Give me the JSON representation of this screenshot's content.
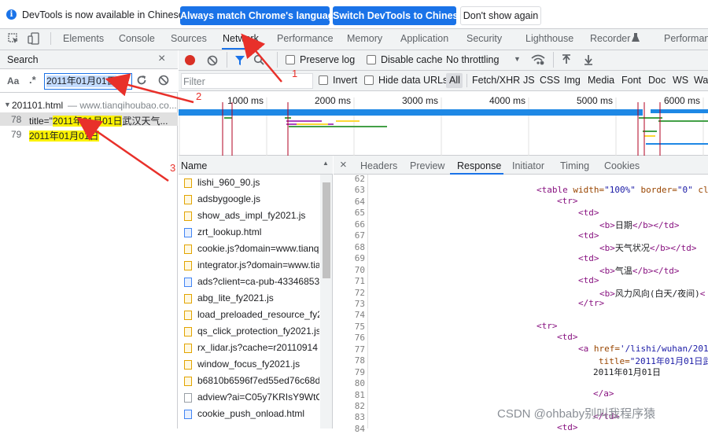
{
  "infobar": {
    "text": "DevTools is now available in Chinese!",
    "btn_match": "Always match Chrome's language",
    "btn_switch": "Switch DevTools to Chinese",
    "btn_dont": "Don't show again"
  },
  "tabs": [
    "Elements",
    "Console",
    "Sources",
    "Network",
    "Performance",
    "Memory",
    "Application",
    "Security",
    "Lighthouse",
    "Recorder",
    "Performan"
  ],
  "search": {
    "title": "Search",
    "case_label": "Aa",
    "regex_label": ".*",
    "query": "2011年01月01日",
    "result_file": "201101.html",
    "result_host": "— www.tianqihoubao.co...",
    "results": [
      {
        "line": "78",
        "prefix": "title=\"",
        "match": "2011年01月01日",
        "suffix": "武汉天气..."
      },
      {
        "line": "79",
        "prefix": "",
        "match": "2011年01月01日",
        "suffix": ""
      }
    ]
  },
  "network_toolbar": {
    "preserve_log": "Preserve log",
    "disable_cache": "Disable cache",
    "throttling": "No throttling"
  },
  "filter_bar": {
    "placeholder": "Filter",
    "invert": "Invert",
    "hide_data_urls": "Hide data URLs",
    "types": [
      "All",
      "Fetch/XHR",
      "JS",
      "CSS",
      "Img",
      "Media",
      "Font",
      "Doc",
      "WS",
      "Wa"
    ]
  },
  "timeline": {
    "ticks": [
      "1000 ms",
      "2000 ms",
      "3000 ms",
      "4000 ms",
      "5000 ms",
      "6000 ms"
    ]
  },
  "annotations": [
    "1",
    "2",
    "3"
  ],
  "requests": {
    "header": "Name",
    "items": [
      {
        "name": "lishi_960_90.js",
        "kind": "js"
      },
      {
        "name": "adsbygoogle.js",
        "kind": "js"
      },
      {
        "name": "show_ads_impl_fy2021.js",
        "kind": "js"
      },
      {
        "name": "zrt_lookup.html",
        "kind": "doc"
      },
      {
        "name": "cookie.js?domain=www.tianq",
        "kind": "js"
      },
      {
        "name": "integrator.js?domain=www.tia",
        "kind": "js"
      },
      {
        "name": "ads?client=ca-pub-43346853",
        "kind": "doc"
      },
      {
        "name": "abg_lite_fy2021.js",
        "kind": "js"
      },
      {
        "name": "load_preloaded_resource_fy2.",
        "kind": "js"
      },
      {
        "name": "qs_click_protection_fy2021.js",
        "kind": "js"
      },
      {
        "name": "rx_lidar.js?cache=r20110914",
        "kind": "js"
      },
      {
        "name": "window_focus_fy2021.js",
        "kind": "js"
      },
      {
        "name": "b6810b6596f7ed55ed76c68d",
        "kind": "js"
      },
      {
        "name": "adview?ai=C05y7KRIsY9WtOc",
        "kind": "blank"
      },
      {
        "name": "cookie_push_onload.html",
        "kind": "doc"
      }
    ]
  },
  "detail_tabs": [
    "Headers",
    "Preview",
    "Response",
    "Initiator",
    "Timing",
    "Cookies"
  ],
  "response": {
    "line_numbers": [
      "62",
      "63",
      "64",
      "65",
      "66",
      "67",
      "68",
      "69",
      "70",
      "71",
      "72",
      "73",
      "74",
      "75",
      "76",
      "77",
      "78",
      "79",
      "80",
      "81",
      "82",
      "83",
      "84"
    ],
    "l63_tag": "<table",
    "l63_a1": " width=",
    "l63_v1": "\"100%\"",
    "l63_a2": " border=",
    "l63_v2": "\"0\"",
    "l63_a3": " cl",
    "l64": "<tr>",
    "l65": "<td>",
    "l66_open": "<b>",
    "l66_text": "日期",
    "l66_close": "</b></td>",
    "l67": "<td>",
    "l68_open": "<b>",
    "l68_text": "天气状况",
    "l68_close": "</b></td>",
    "l69": "<td>",
    "l70_open": "<b>",
    "l70_text": "气温",
    "l70_close": "</b></td>",
    "l71": "<td>",
    "l72_open": "<b>",
    "l72_text": "风力风向(白天/夜间)",
    "l72_close": "<",
    "l73": "</tr>",
    "l75": "<tr>",
    "l76": "<td>",
    "l77_tag": "<a",
    "l77_attr": " href=",
    "l77_val": "'/lishi/wuhan/201",
    "l78_attr": "title=",
    "l78_val": "\"2011年01月01日武",
    "l79_text": "2011年01月01日",
    "l81": "</a>",
    "l82": "</td>",
    "l84": "<td>"
  },
  "watermark": "CSDN @ohbaby别叫我程序猿",
  "colors": {
    "accent": "#1a73e8",
    "highlight": "#fbf200",
    "annotation_red": "#e8302a",
    "record_red": "#d93025"
  }
}
